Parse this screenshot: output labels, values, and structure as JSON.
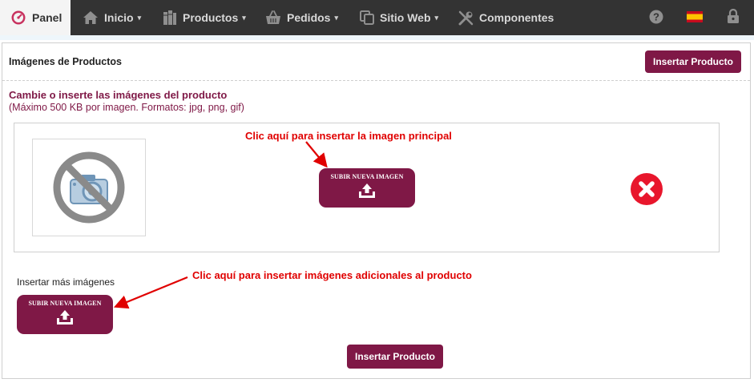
{
  "navbar": {
    "panel": "Panel",
    "inicio": "Inicio",
    "productos": "Productos",
    "pedidos": "Pedidos",
    "sitio_web": "Sitio Web",
    "componentes": "Componentes",
    "caret": "▾"
  },
  "card": {
    "title": "Imágenes de Productos",
    "insert_button": "Insertar Producto",
    "subtitle": "Cambie o inserte las imágenes del producto",
    "note": "(Máximo 500 KB por imagen. Formatos: jpg, png, gif)",
    "upload_label": "SUBIR NUEVA IMAGEN",
    "more_images": "Insertar más imágenes",
    "bottom_button": "Insertar Producto"
  },
  "annotations": {
    "main_hint": "Clic aquí para insertar la imagen principal",
    "extra_hint": "Clic aquí para insertar imágenes adicionales al producto"
  },
  "colors": {
    "navbar": "#333333",
    "accent": "#7f1846",
    "annotation": "#e00000",
    "delete": "#e8162c"
  },
  "icons": {
    "panel": "dashboard-icon",
    "inicio": "home-icon",
    "productos": "books-icon",
    "pedidos": "shopping-basket-icon",
    "sitio_web": "copy-icon",
    "componentes": "wrench-icon",
    "help": "question-circle-icon",
    "language": "spain-flag-icon",
    "lock": "lock-icon",
    "no_image": "no-photo-icon",
    "upload": "upload-tray-icon",
    "delete": "delete-circle-icon"
  }
}
